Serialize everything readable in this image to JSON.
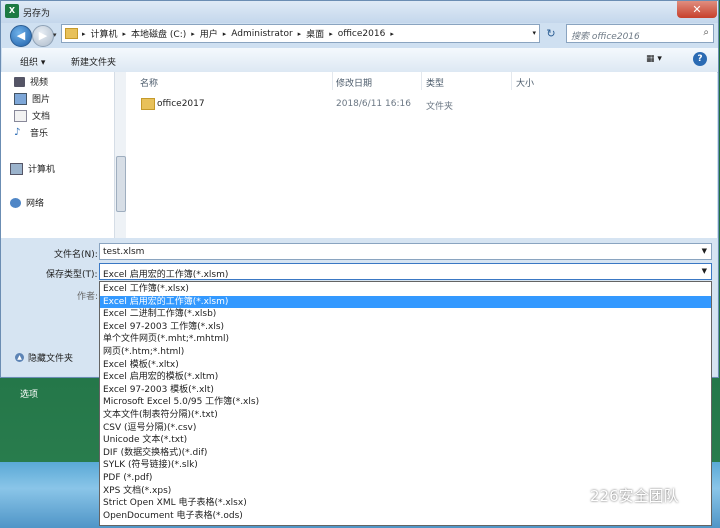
{
  "dialog": {
    "title": "另存为",
    "app_icon": "X",
    "close": "✕"
  },
  "nav": {
    "breadcrumbs": [
      "计算机",
      "本地磁盘 (C:)",
      "用户",
      "Administrator",
      "桌面",
      "office2016"
    ],
    "search_placeholder": "搜索 office2016"
  },
  "toolbar": {
    "organize": "组织 ▾",
    "new_folder": "新建文件夹",
    "view": "▦ ▾",
    "help": "?"
  },
  "sidebar": {
    "items": [
      {
        "label": "视频",
        "icon": "video-icon"
      },
      {
        "label": "图片",
        "icon": "pictures-icon"
      },
      {
        "label": "文档",
        "icon": "documents-icon"
      },
      {
        "label": "音乐",
        "icon": "music-icon"
      },
      {
        "label": "计算机",
        "icon": "computer-icon"
      },
      {
        "label": "网络",
        "icon": "network-icon"
      }
    ]
  },
  "file_list": {
    "columns": [
      "名称",
      "修改日期",
      "类型",
      "大小"
    ],
    "rows": [
      {
        "name": "office2017",
        "modified": "2018/6/11 16:16",
        "type": "文件夹",
        "size": ""
      }
    ]
  },
  "form": {
    "filename_label": "文件名(N):",
    "filename_value": "test.xlsm",
    "filetype_label": "保存类型(T):",
    "filetype_value": "Excel 启用宏的工作簿(*.xlsm)",
    "author_label": "作者:",
    "hide_folders": "隐藏文件夹"
  },
  "filetype_options": [
    "Excel 工作簿(*.xlsx)",
    "Excel 启用宏的工作簿(*.xlsm)",
    "Excel 二进制工作簿(*.xlsb)",
    "Excel 97-2003 工作簿(*.xls)",
    "单个文件网页(*.mht;*.mhtml)",
    "网页(*.htm;*.html)",
    "Excel 模板(*.xltx)",
    "Excel 启用宏的模板(*.xltm)",
    "Excel 97-2003 模板(*.xlt)",
    "Microsoft Excel 5.0/95 工作簿(*.xls)",
    "文本文件(制表符分隔)(*.txt)",
    "CSV (逗号分隔)(*.csv)",
    "Unicode 文本(*.txt)",
    "DIF (数据交换格式)(*.dif)",
    "SYLK (符号链接)(*.slk)",
    "PDF (*.pdf)",
    "XPS 文档(*.xps)",
    "Strict Open XML 电子表格(*.xlsx)",
    "OpenDocument 电子表格(*.ods)"
  ],
  "selected_option_index": 1,
  "background": {
    "options_label": "选项"
  },
  "watermark": "226安全团队"
}
